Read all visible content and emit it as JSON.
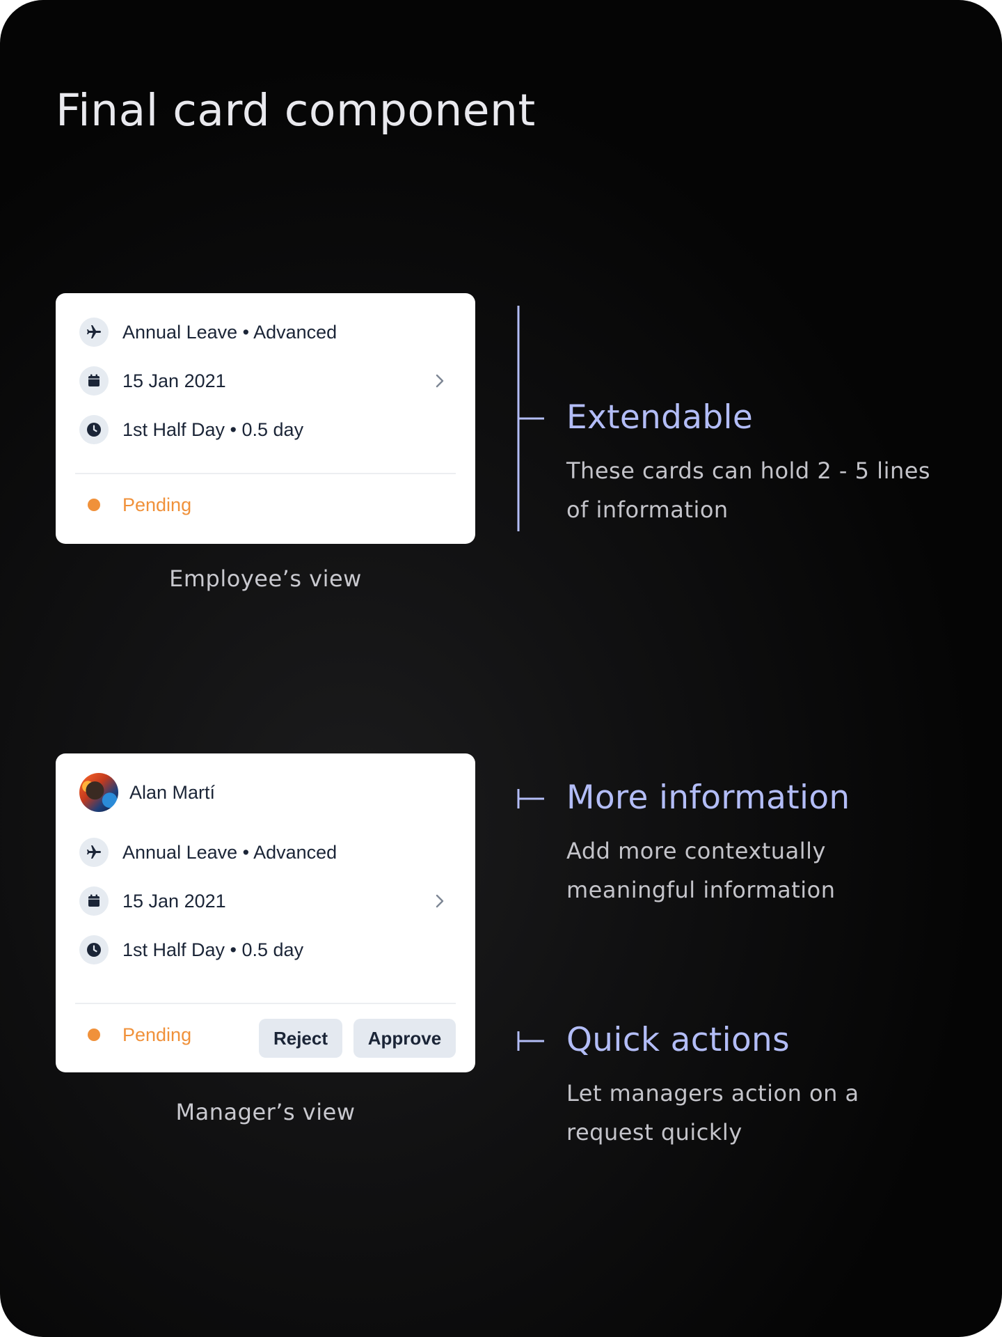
{
  "title": "Final card component",
  "employee_card": {
    "rows": [
      {
        "icon": "plane-icon",
        "text": "Annual Leave • Advanced"
      },
      {
        "icon": "calendar-icon",
        "text": "15 Jan 2021"
      },
      {
        "icon": "clock-icon",
        "text": "1st Half Day • 0.5 day"
      }
    ],
    "status": "Pending",
    "caption": "Employee’s view"
  },
  "manager_card": {
    "name": "Alan Martí",
    "rows": [
      {
        "icon": "plane-icon",
        "text": "Annual Leave • Advanced"
      },
      {
        "icon": "calendar-icon",
        "text": "15 Jan 2021"
      },
      {
        "icon": "clock-icon",
        "text": "1st Half Day • 0.5 day"
      }
    ],
    "status": "Pending",
    "reject_label": "Reject",
    "approve_label": "Approve",
    "caption": "Manager’s view"
  },
  "annotations": [
    {
      "title": "Extendable",
      "description": "These cards can hold 2 - 5 lines of information"
    },
    {
      "title": "More information",
      "description": "Add more contextually meaningful information"
    },
    {
      "title": "Quick actions",
      "description": "Let managers action on a request quickly"
    }
  ],
  "colors": {
    "accent": "#b3bdf7",
    "status_pending": "#f0913a",
    "text_dark": "#1b2537",
    "icon_bg": "#e6ebf1"
  }
}
